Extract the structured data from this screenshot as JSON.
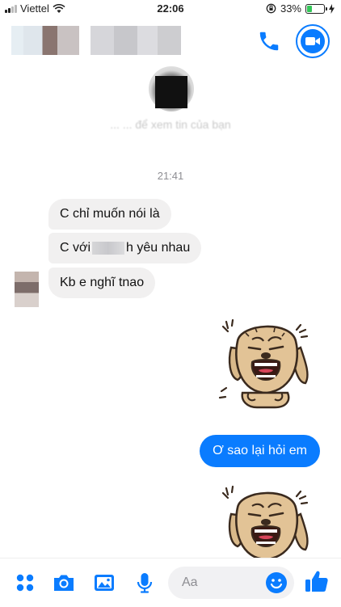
{
  "status_bar": {
    "carrier": "Viettel",
    "time": "22:06",
    "battery_percent": "33%",
    "battery_level": 0.33
  },
  "header": {
    "call_icon": "phone-icon",
    "video_icon": "video-camera-icon"
  },
  "profile": {
    "subtitle": "... ... để xem tin của bạn"
  },
  "conversation": {
    "timestamp": "21:41",
    "incoming": [
      {
        "text": "C chỉ muốn nói là"
      },
      {
        "text_before": "C với",
        "text_after": "h yêu nhau"
      },
      {
        "text": "Kb e nghĩ tnao"
      }
    ],
    "outgoing": [
      {
        "text": "Ơ sao lại hỏi em"
      }
    ]
  },
  "composer": {
    "placeholder": "Aa",
    "icons": [
      "apps-icon",
      "camera-icon",
      "photo-icon",
      "microphone-icon",
      "emoji-icon",
      "thumbs-up-icon"
    ]
  },
  "colors": {
    "accent": "#0a7cff",
    "incoming_bubble": "#f1f0f0",
    "outgoing_bubble": "#0a7cff"
  }
}
